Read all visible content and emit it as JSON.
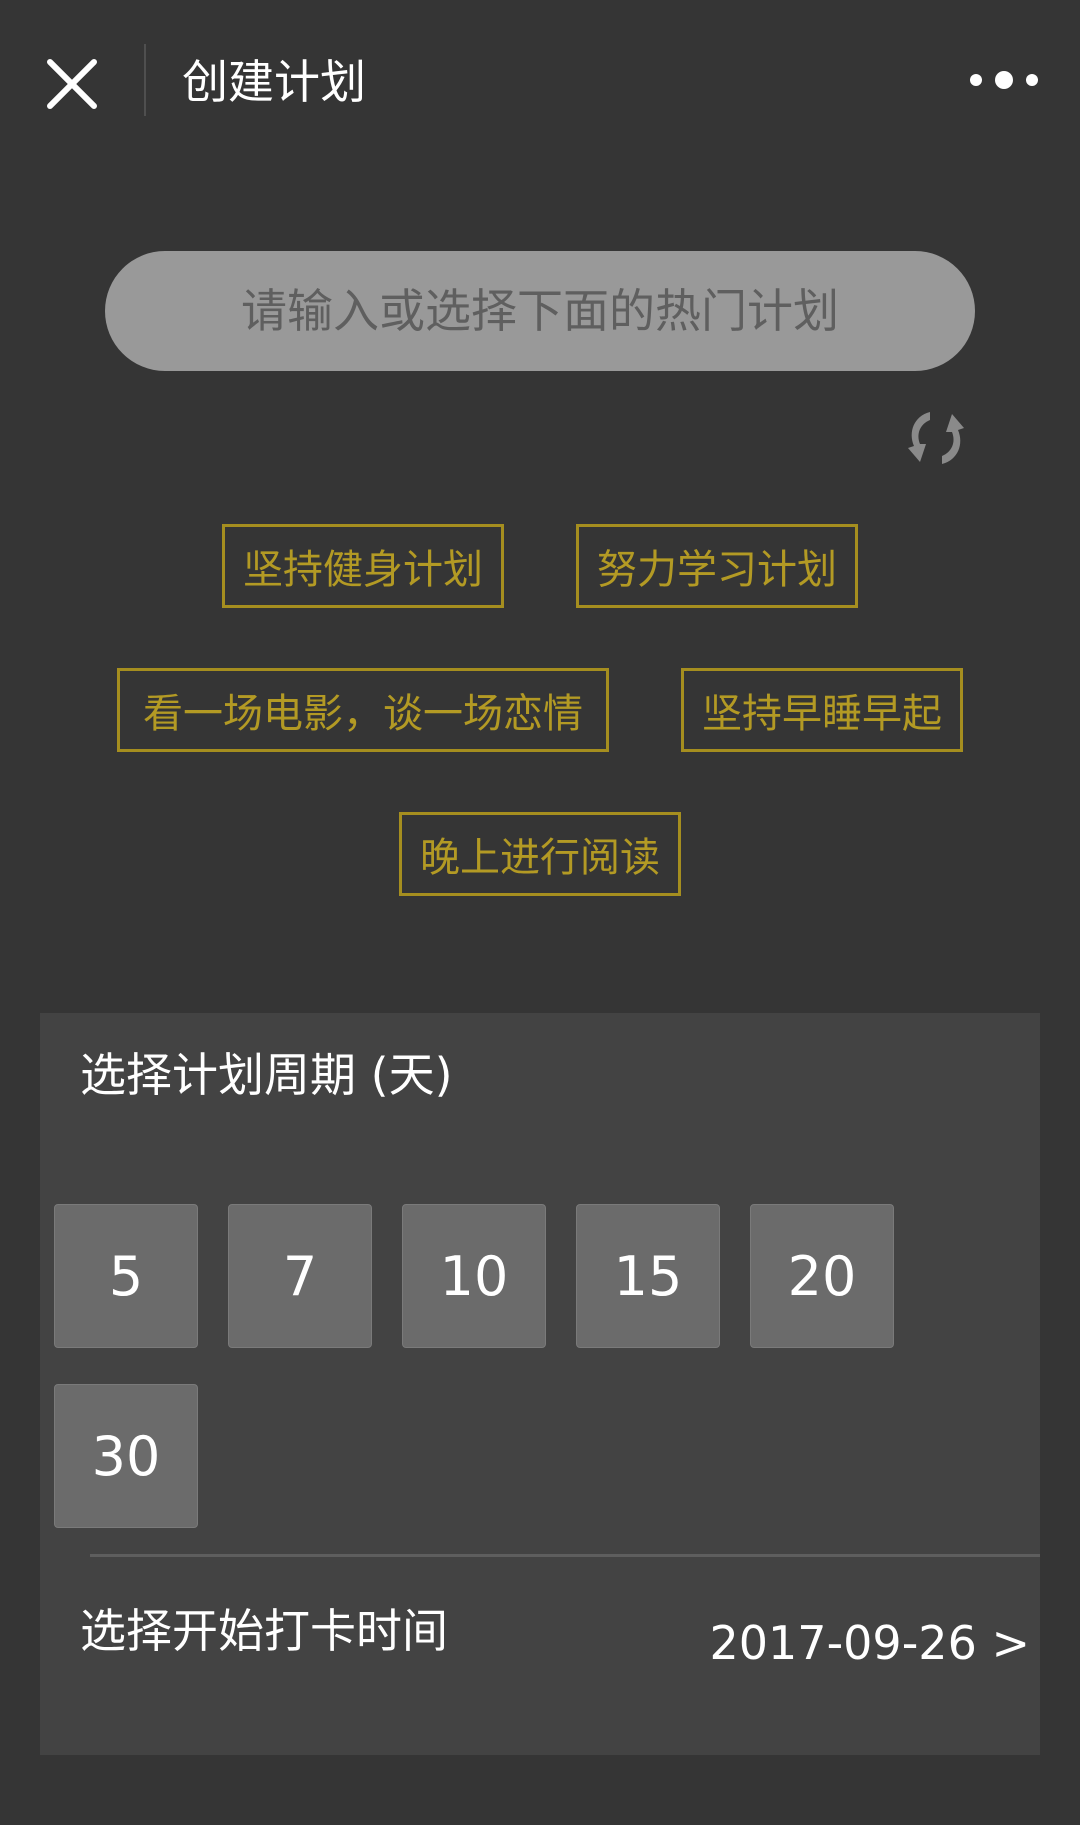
{
  "navbar": {
    "title": "创建计划",
    "close_icon": "close-icon",
    "more_icon": "more-dots-icon"
  },
  "search": {
    "placeholder": "请输入或选择下面的热门计划",
    "value": ""
  },
  "refresh_icon": "refresh-icon",
  "hot_plans": [
    "坚持健身计划",
    "努力学习计划",
    "看一场电影，谈一场恋情",
    "坚持早睡早起",
    "晚上进行阅读"
  ],
  "period": {
    "title": "选择计划周期 (天)",
    "options": [
      "5",
      "7",
      "10",
      "15",
      "20",
      "30"
    ]
  },
  "start": {
    "label": "选择开始打卡时间",
    "value": "2017-09-26 >"
  },
  "colors": {
    "background": "#353535",
    "panel": "#434343",
    "accent_gold": "#a58e1f",
    "option_bg": "#6b6b6b"
  }
}
